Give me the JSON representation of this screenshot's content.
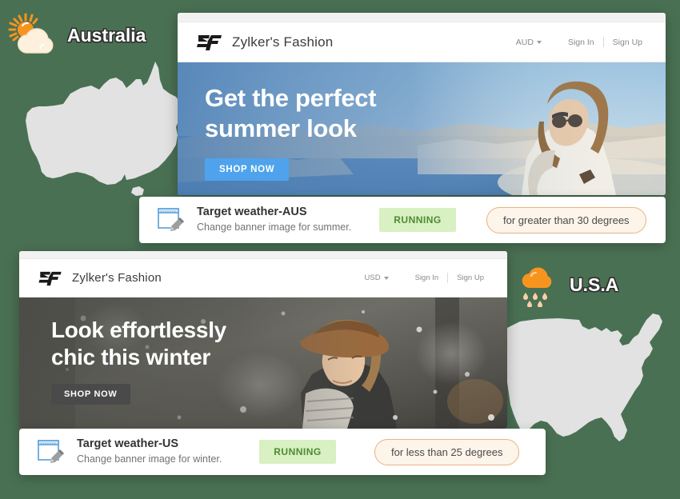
{
  "background_color": "#4a7053",
  "regions": [
    {
      "key": "australia",
      "label": "Australia",
      "weather_icon": "sun-behind-cloud-icon",
      "map_icon": "australia-map-icon"
    },
    {
      "key": "usa",
      "label": "U.S.A",
      "weather_icon": "rain-cloud-icon",
      "map_icon": "usa-map-icon"
    }
  ],
  "windows": [
    {
      "key": "aus",
      "brand": {
        "logo_icon": "zylker-zf-logo-icon",
        "name": "Zylker's Fashion"
      },
      "header": {
        "currency": "AUD",
        "currency_caret_icon": "chevron-down-icon",
        "sign_in": "Sign In",
        "sign_up": "Sign Up"
      },
      "hero": {
        "title_line1": "Get the perfect",
        "title_line2": "summer look",
        "cta_label": "SHOP NOW",
        "cta_color": "#4ea3ec",
        "image_alt": "summer-beach-model-photo"
      }
    },
    {
      "key": "us",
      "brand": {
        "logo_icon": "zylker-zf-logo-icon",
        "name": "Zylker's Fashion"
      },
      "header": {
        "currency": "USD",
        "currency_caret_icon": "chevron-down-icon",
        "sign_in": "Sign In",
        "sign_up": "Sign Up"
      },
      "hero": {
        "title_line1": "Look effortlessly",
        "title_line2": "chic this winter",
        "cta_label": "SHOP NOW",
        "cta_color": "#4a4a4a",
        "image_alt": "winter-snow-model-photo"
      }
    }
  ],
  "automation_cards": [
    {
      "key": "aus",
      "icon": "browser-window-edit-icon",
      "title": "Target weather-AUS",
      "subtitle": "Change banner image for summer.",
      "status": "RUNNING",
      "status_bg": "#d8f0c2",
      "status_color": "#4e8b32",
      "condition": "for greater than 30 degrees",
      "condition_bg": "#fdf4ea",
      "condition_border": "#e8b480"
    },
    {
      "key": "us",
      "icon": "browser-window-edit-icon",
      "title": "Target weather-US",
      "subtitle": "Change banner image for winter.",
      "status": "RUNNING",
      "status_bg": "#d8f0c2",
      "status_color": "#4e8b32",
      "condition": "for less than 25 degrees",
      "condition_bg": "#fdf4ea",
      "condition_border": "#e8b480"
    }
  ]
}
